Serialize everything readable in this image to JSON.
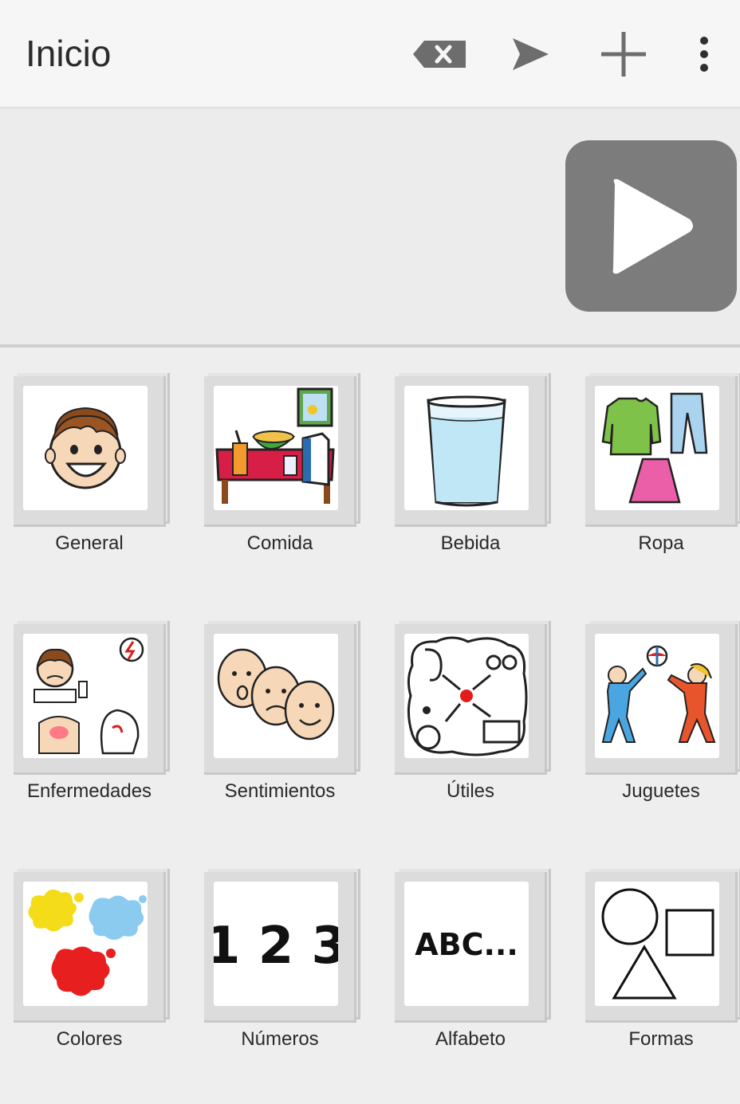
{
  "toolbar": {
    "title": "Inicio",
    "backspace_icon": "backspace-icon",
    "send_icon": "send-icon",
    "add_icon": "plus-icon",
    "menu_icon": "more-vert-icon"
  },
  "speech_area": {
    "play_icon": "play-icon"
  },
  "categories": [
    {
      "label": "General",
      "icon": "boy-face"
    },
    {
      "label": "Comida",
      "icon": "food-table"
    },
    {
      "label": "Bebida",
      "icon": "water-glass"
    },
    {
      "label": "Ropa",
      "icon": "clothes"
    },
    {
      "label": "Enfermedades",
      "icon": "sick-person"
    },
    {
      "label": "Sentimientos",
      "icon": "feeling-faces"
    },
    {
      "label": "Útiles",
      "icon": "aids-devices"
    },
    {
      "label": "Juguetes",
      "icon": "kids-playing-ball"
    },
    {
      "label": "Colores",
      "icon": "paint-splashes"
    },
    {
      "label": "Números",
      "icon": "numbers"
    },
    {
      "label": "Alfabeto",
      "icon": "letters"
    },
    {
      "label": "Formas",
      "icon": "shapes"
    }
  ],
  "numbers_text": "1 2 3",
  "alphabet_text": "ABC...",
  "colors": {
    "appbar_bg": "#f6f6f6",
    "body_bg": "#eeeeee",
    "play_button": "#7c7c7c"
  }
}
